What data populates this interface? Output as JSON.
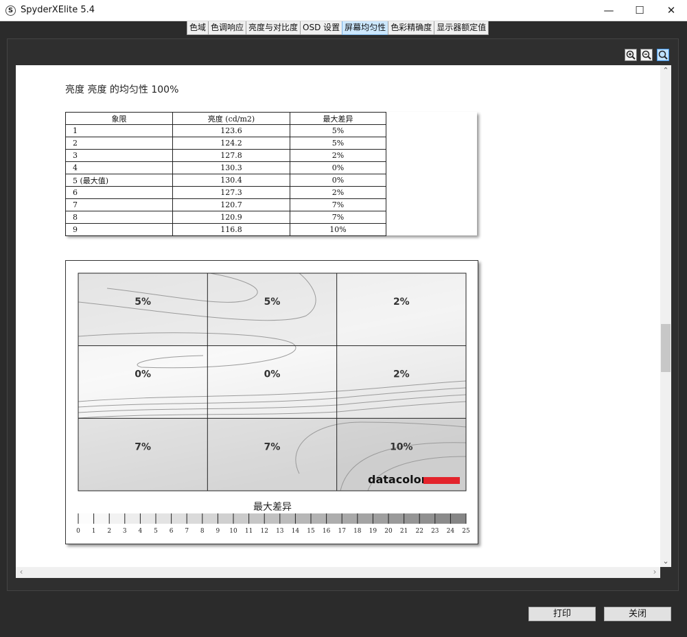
{
  "window": {
    "app_logo": "S",
    "title": "SpyderXElite 5.4",
    "minimize": "—",
    "maximize": "☐",
    "close": "✕"
  },
  "tabs": [
    {
      "label": "色域",
      "active": false
    },
    {
      "label": "色调响应",
      "active": false
    },
    {
      "label": "亮度与对比度",
      "active": false
    },
    {
      "label": "OSD 设置",
      "active": false
    },
    {
      "label": "屏幕均匀性",
      "active": true
    },
    {
      "label": "色彩精确度",
      "active": false
    },
    {
      "label": "显示器额定值",
      "active": false
    }
  ],
  "toolbar": {
    "zoom_in_icon": "zoom-in",
    "zoom_out_icon": "zoom-out",
    "zoom_fit_icon": "zoom-fit"
  },
  "report": {
    "title": "亮度 亮度 的均匀性 100%",
    "table": {
      "headers": [
        "象限",
        "亮度 (cd/m2)",
        "最大差异"
      ],
      "rows": [
        [
          "1",
          "123.6",
          "5%"
        ],
        [
          "2",
          "124.2",
          "5%"
        ],
        [
          "3",
          "127.8",
          "2%"
        ],
        [
          "4",
          "130.3",
          "0%"
        ],
        [
          "5 (最大值)",
          "130.4",
          "0%"
        ],
        [
          "6",
          "127.3",
          "2%"
        ],
        [
          "7",
          "120.7",
          "7%"
        ],
        [
          "8",
          "120.9",
          "7%"
        ],
        [
          "9",
          "116.8",
          "10%"
        ]
      ]
    }
  },
  "chart_data": {
    "type": "heatmap",
    "title": "",
    "grid": {
      "rows": 3,
      "cols": 3
    },
    "cells": [
      [
        "5%",
        "5%",
        "2%"
      ],
      [
        "0%",
        "0%",
        "2%"
      ],
      [
        "7%",
        "7%",
        "10%"
      ]
    ],
    "values": [
      [
        5,
        5,
        2
      ],
      [
        0,
        0,
        2
      ],
      [
        7,
        7,
        10
      ]
    ],
    "legend_title": "最大差异",
    "legend_ticks": [
      "0",
      "1",
      "2",
      "3",
      "4",
      "5",
      "6",
      "7",
      "8",
      "9",
      "10",
      "11",
      "12",
      "13",
      "14",
      "15",
      "16",
      "17",
      "18",
      "19",
      "20",
      "21",
      "22",
      "23",
      "24",
      "25"
    ],
    "logo_text": "datacolor",
    "colors": {
      "low": "#fafafa",
      "high": "#8a8a8a",
      "brand": "#e3232b"
    }
  },
  "buttons": {
    "print": "打印",
    "close": "关闭"
  }
}
